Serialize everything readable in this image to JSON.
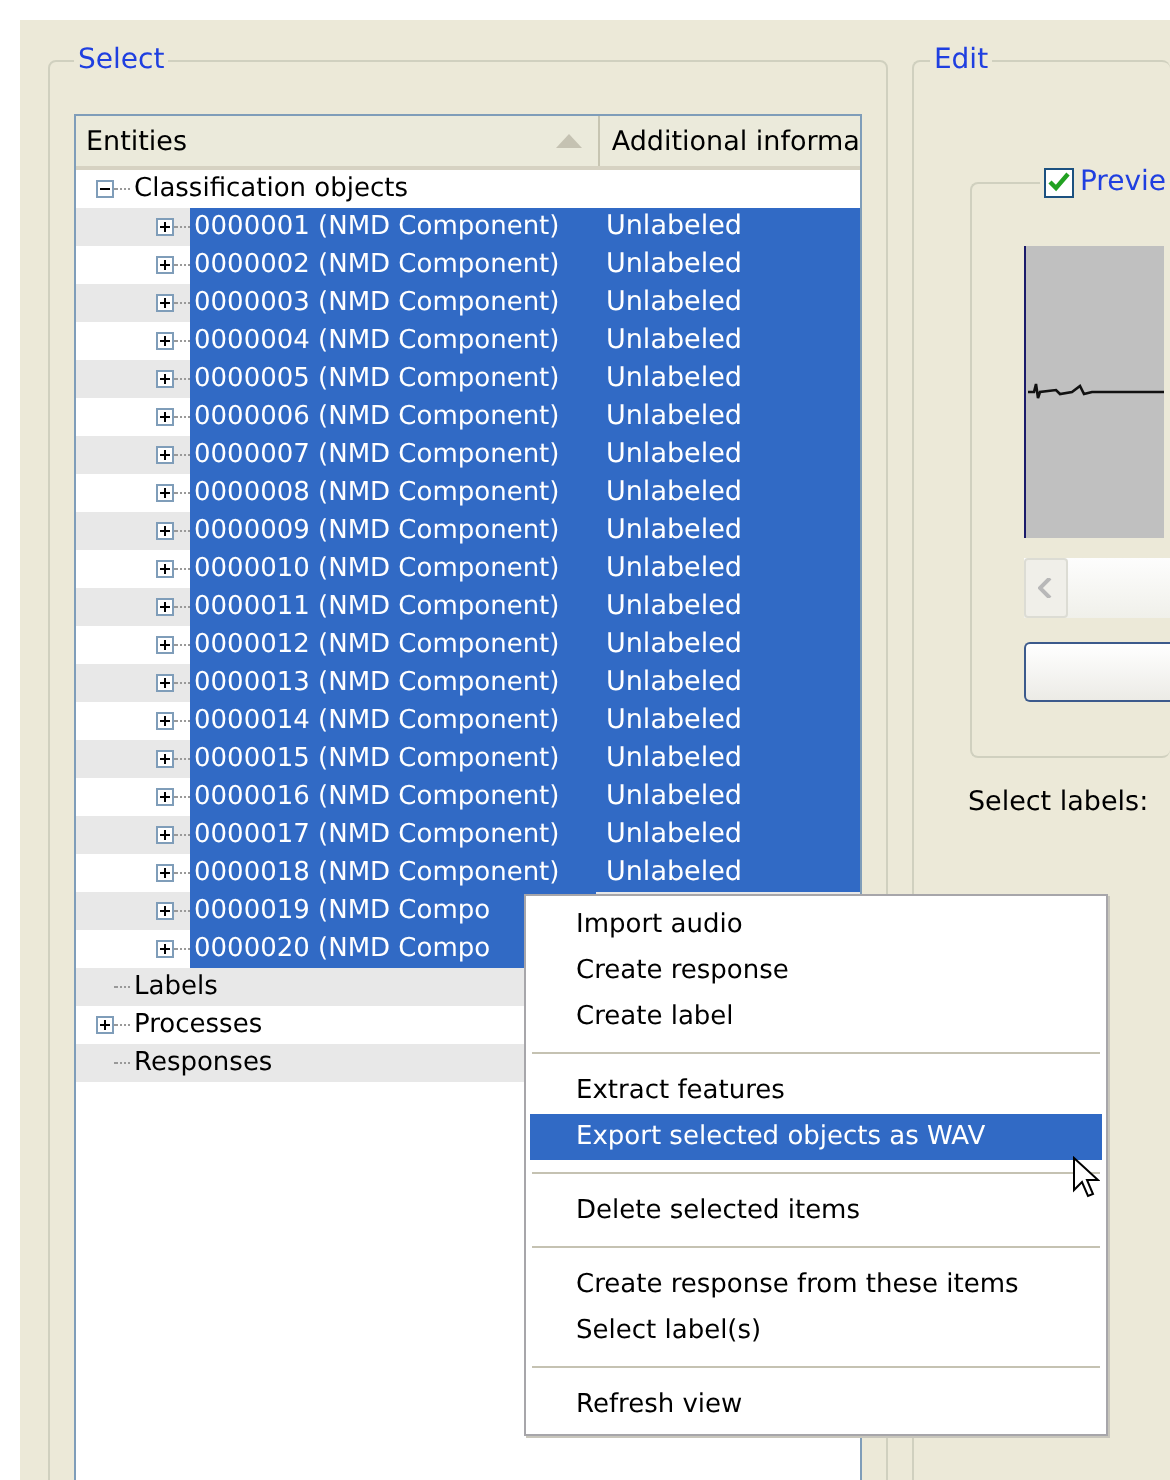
{
  "select_panel": {
    "title": "Select",
    "columns": [
      "Entities",
      "Additional informa"
    ],
    "tree": [
      {
        "label": "Classification objects",
        "expanded": true,
        "selected": false,
        "children": [
          {
            "label": "0000001 (NMD Component)",
            "info": "Unlabeled",
            "expanded": false,
            "selected": true
          },
          {
            "label": "0000002 (NMD Component)",
            "info": "Unlabeled",
            "expanded": false,
            "selected": true
          },
          {
            "label": "0000003 (NMD Component)",
            "info": "Unlabeled",
            "expanded": false,
            "selected": true
          },
          {
            "label": "0000004 (NMD Component)",
            "info": "Unlabeled",
            "expanded": false,
            "selected": true
          },
          {
            "label": "0000005 (NMD Component)",
            "info": "Unlabeled",
            "expanded": false,
            "selected": true
          },
          {
            "label": "0000006 (NMD Component)",
            "info": "Unlabeled",
            "expanded": false,
            "selected": true
          },
          {
            "label": "0000007 (NMD Component)",
            "info": "Unlabeled",
            "expanded": false,
            "selected": true
          },
          {
            "label": "0000008 (NMD Component)",
            "info": "Unlabeled",
            "expanded": false,
            "selected": true
          },
          {
            "label": "0000009 (NMD Component)",
            "info": "Unlabeled",
            "expanded": false,
            "selected": true
          },
          {
            "label": "0000010 (NMD Component)",
            "info": "Unlabeled",
            "expanded": false,
            "selected": true
          },
          {
            "label": "0000011 (NMD Component)",
            "info": "Unlabeled",
            "expanded": false,
            "selected": true
          },
          {
            "label": "0000012 (NMD Component)",
            "info": "Unlabeled",
            "expanded": false,
            "selected": true
          },
          {
            "label": "0000013 (NMD Component)",
            "info": "Unlabeled",
            "expanded": false,
            "selected": true
          },
          {
            "label": "0000014 (NMD Component)",
            "info": "Unlabeled",
            "expanded": false,
            "selected": true
          },
          {
            "label": "0000015 (NMD Component)",
            "info": "Unlabeled",
            "expanded": false,
            "selected": true
          },
          {
            "label": "0000016 (NMD Component)",
            "info": "Unlabeled",
            "expanded": false,
            "selected": true
          },
          {
            "label": "0000017 (NMD Component)",
            "info": "Unlabeled",
            "expanded": false,
            "selected": true
          },
          {
            "label": "0000018 (NMD Component)",
            "info": "Unlabeled",
            "expanded": false,
            "selected": true
          },
          {
            "label": "0000019 (NMD Compo",
            "expanded": false,
            "selected": true
          },
          {
            "label": "0000020 (NMD Compo",
            "expanded": false,
            "selected": true
          }
        ]
      },
      {
        "label": "Labels",
        "selected": false
      },
      {
        "label": "Processes",
        "expanded": false,
        "selected": false
      },
      {
        "label": "Responses",
        "selected": false
      }
    ]
  },
  "edit_panel": {
    "title": "Edit",
    "preview": {
      "label": "Previe",
      "checked": true
    },
    "select_labels": "Select labels:"
  },
  "context_menu": {
    "items": [
      {
        "kind": "item",
        "label": "Import audio",
        "selected": false
      },
      {
        "kind": "item",
        "label": "Create response",
        "selected": false
      },
      {
        "kind": "item",
        "label": "Create label",
        "selected": false
      },
      {
        "kind": "separator"
      },
      {
        "kind": "item",
        "label": "Extract features",
        "selected": false
      },
      {
        "kind": "item",
        "label": "Export selected objects as WAV",
        "selected": true
      },
      {
        "kind": "separator"
      },
      {
        "kind": "item",
        "label": "Delete selected items",
        "selected": false
      },
      {
        "kind": "separator"
      },
      {
        "kind": "item",
        "label": "Create response from these items",
        "selected": false
      },
      {
        "kind": "item",
        "label": "Select label(s)",
        "selected": false
      },
      {
        "kind": "separator"
      },
      {
        "kind": "item",
        "label": "Refresh view",
        "selected": false
      }
    ]
  }
}
